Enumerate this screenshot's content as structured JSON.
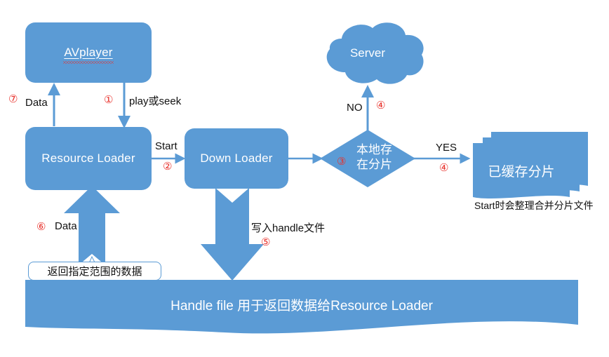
{
  "diagram": {
    "title": "AVPlayer resource loading flowchart",
    "colors": {
      "fill": "#5B9BD5",
      "arrow": "#5B9BD5",
      "number": "#e8302a",
      "text": "#111111",
      "shape_text": "#ffffff",
      "background": "#ffffff"
    },
    "nodes": {
      "avplayer": {
        "label": "AVplayer"
      },
      "resource_loader": {
        "label": "Resource Loader"
      },
      "down_loader": {
        "label": "Down Loader"
      },
      "server": {
        "label": "Server"
      },
      "decision": {
        "number": "③",
        "line1": "本地存",
        "line2": "在分片"
      },
      "cached_slices": {
        "label": "已缓存分片",
        "caption": "Start时会整理合并分片文件"
      },
      "handle_file": {
        "label": "Handle file 用于返回数据给Resource Loader"
      },
      "callout": {
        "label": "返回指定范围的数据"
      }
    },
    "edges": {
      "data_up": {
        "number": "⑦",
        "label": "Data"
      },
      "play_seek": {
        "number": "①",
        "label": "play或seek"
      },
      "start": {
        "number": "②",
        "label": "Start"
      },
      "no_branch": {
        "number": "④",
        "label": "NO"
      },
      "yes_branch": {
        "number": "④",
        "label": "YES"
      },
      "write_handle": {
        "number": "⑤",
        "label": "写入handle文件"
      },
      "data_return": {
        "number": "⑥",
        "label": "Data"
      }
    }
  }
}
